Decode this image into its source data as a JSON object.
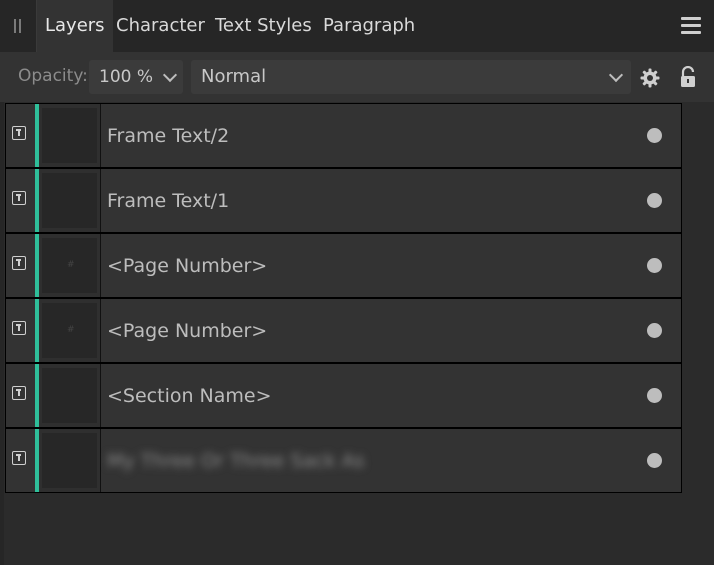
{
  "tabs": [
    {
      "label": "Layers",
      "active": true
    },
    {
      "label": "Character",
      "active": false
    },
    {
      "label": "Text Styles",
      "active": false
    },
    {
      "label": "Paragraph",
      "active": false
    }
  ],
  "toolbar": {
    "opacity_label": "Opacity:",
    "opacity_value": "100 %",
    "blend_mode": "Normal"
  },
  "layers": [
    {
      "name": "Frame Text/2",
      "type": "text-frame"
    },
    {
      "name": "Frame Text/1",
      "type": "text-frame"
    },
    {
      "name": "<Page Number>",
      "type": "text-frame",
      "thumb_mark": "#"
    },
    {
      "name": "<Page Number>",
      "type": "text-frame",
      "thumb_mark": "#"
    },
    {
      "name": "<Section Name>",
      "type": "text-frame"
    },
    {
      "name": "My Three Or Three Sack As",
      "type": "text-frame",
      "blurred": true
    }
  ],
  "colors": {
    "accent": "#2fbf9a",
    "background": "#2b2b2b",
    "row": "#333333"
  },
  "icons": [
    "grip-icon",
    "hamburger-menu-icon",
    "chevron-down-icon",
    "gear-icon",
    "lock-icon",
    "text-frame-icon",
    "visibility-dot-icon"
  ]
}
